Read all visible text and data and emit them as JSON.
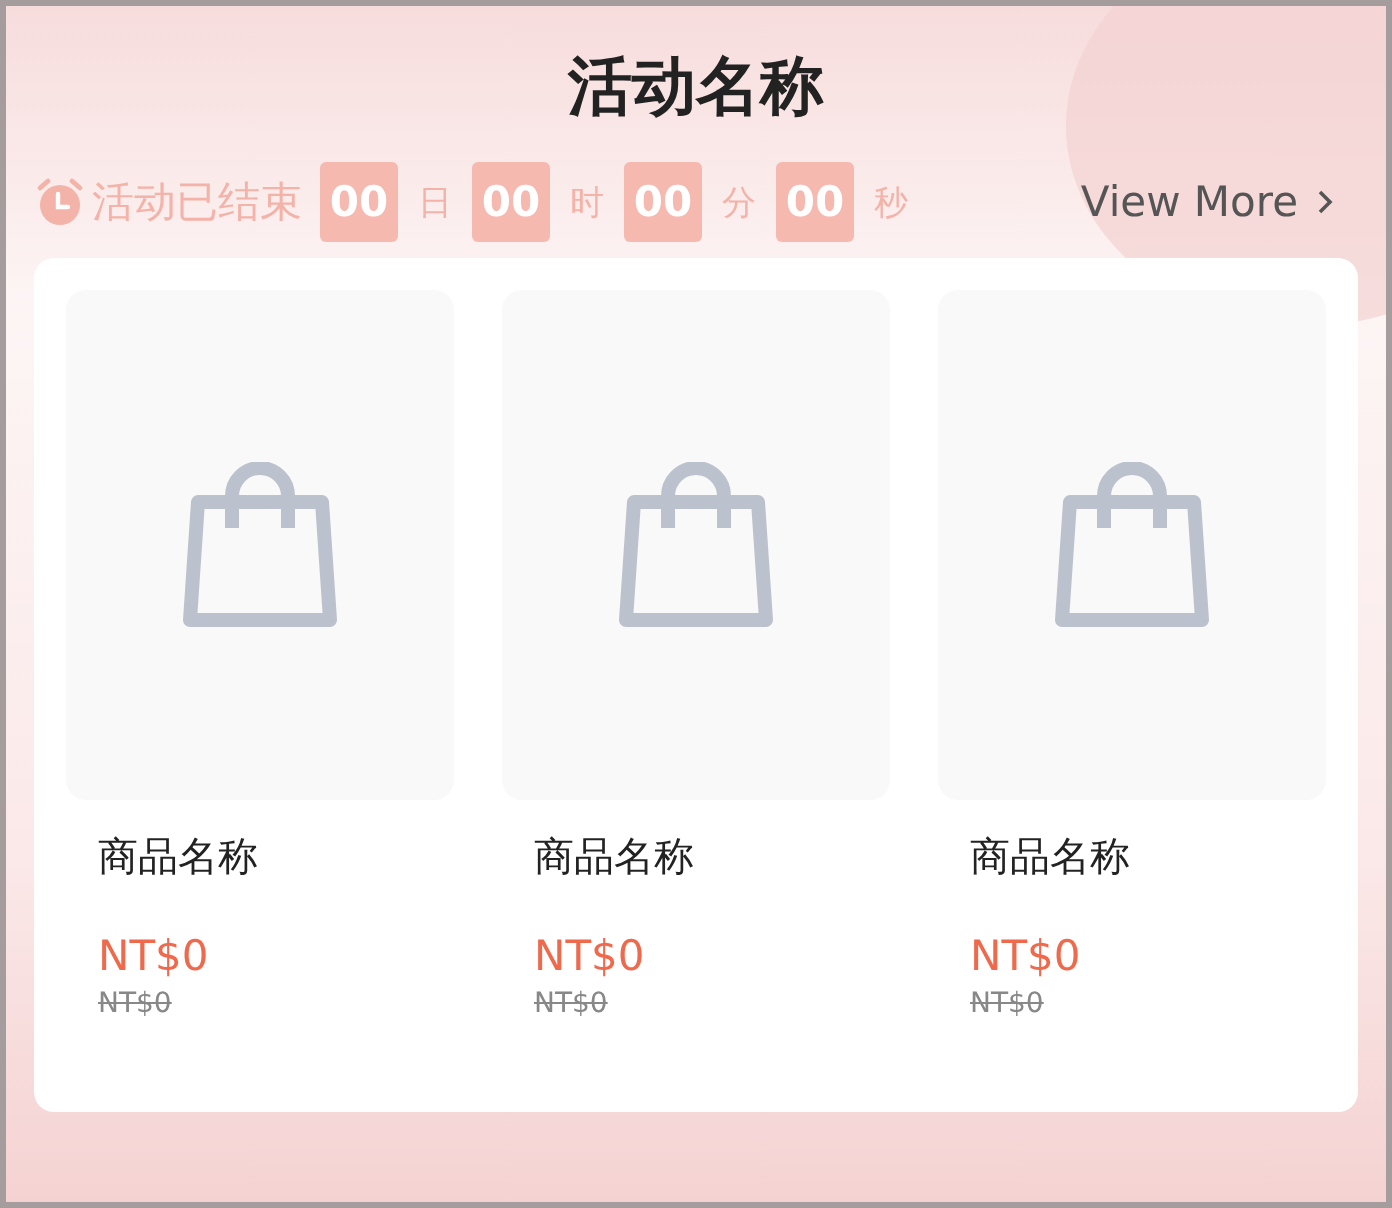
{
  "title": "活动名称",
  "countdown": {
    "label": "活动已结束",
    "segments": [
      {
        "value": "00",
        "unit": "日"
      },
      {
        "value": "00",
        "unit": "时"
      },
      {
        "value": "00",
        "unit": "分"
      },
      {
        "value": "00",
        "unit": "秒"
      }
    ]
  },
  "view_more": {
    "label": "View More"
  },
  "products": [
    {
      "name": "商品名称",
      "price": "NT$0",
      "original_price": "NT$0"
    },
    {
      "name": "商品名称",
      "price": "NT$0",
      "original_price": "NT$0"
    },
    {
      "name": "商品名称",
      "price": "NT$0",
      "original_price": "NT$0"
    }
  ]
}
